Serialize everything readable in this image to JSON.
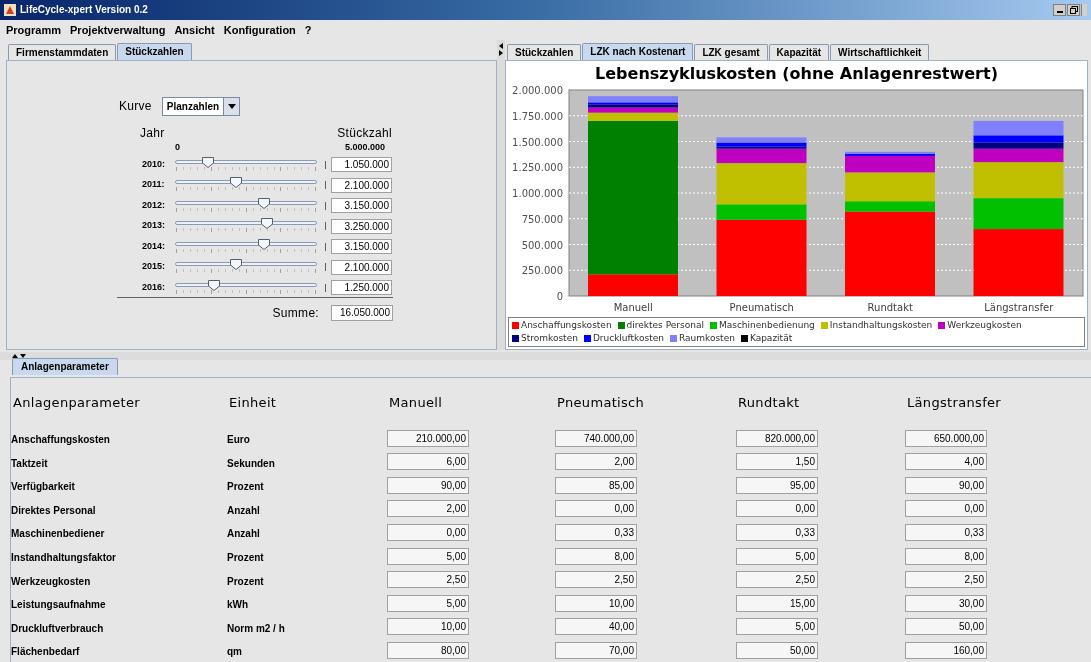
{
  "window": {
    "title": "LifeCycle-xpert Version 0.2"
  },
  "menu": [
    "Programm",
    "Projektverwaltung",
    "Ansicht",
    "Konfiguration",
    "?"
  ],
  "left_tabs": [
    {
      "label": "Firmenstammdaten",
      "selected": false
    },
    {
      "label": "Stückzahlen",
      "selected": true
    }
  ],
  "curve": {
    "label": "Kurve",
    "value": "Planzahlen"
  },
  "years_header": "Jahr",
  "count_header": "Stückzahl",
  "scale_min": "0",
  "scale_max": "5.000.000",
  "years": [
    {
      "label": "2010:",
      "level": 0.21,
      "value": "1.050.000"
    },
    {
      "label": "2011:",
      "level": 0.42,
      "value": "2.100.000"
    },
    {
      "label": "2012:",
      "level": 0.63,
      "value": "3.150.000"
    },
    {
      "label": "2013:",
      "level": 0.65,
      "value": "3.250.000"
    },
    {
      "label": "2014:",
      "level": 0.63,
      "value": "3.150.000"
    },
    {
      "label": "2015:",
      "level": 0.42,
      "value": "2.100.000"
    },
    {
      "label": "2016:",
      "level": 0.25,
      "value": "1.250.000"
    }
  ],
  "sum": {
    "label": "Summe:",
    "value": "16.050.000"
  },
  "chart_tabs": [
    {
      "label": "Stückzahlen",
      "selected": false
    },
    {
      "label": "LZK nach Kostenart",
      "selected": true
    },
    {
      "label": "LZK gesamt",
      "selected": false
    },
    {
      "label": "Kapazität",
      "selected": false
    },
    {
      "label": "Wirtschaftlichkeit",
      "selected": false
    }
  ],
  "chart": {
    "chart_data": {
      "type": "bar",
      "stacked": true,
      "grid": true,
      "legend": "bottom",
      "title": "Lebenszykluskosten (ohne Anlagenrestwert)",
      "categories": [
        "Manuell",
        "Pneumatisch",
        "Rundtakt",
        "Längstransfer"
      ],
      "ylim": [
        0,
        2000000
      ],
      "yticks": [
        {
          "value": 0,
          "label": "0"
        },
        {
          "value": 250000,
          "label": "250.000"
        },
        {
          "value": 500000,
          "label": "500.000"
        },
        {
          "value": 750000,
          "label": "750.000"
        },
        {
          "value": 1000000,
          "label": "1.000.000"
        },
        {
          "value": 1250000,
          "label": "1.250.000"
        },
        {
          "value": 1500000,
          "label": "1.500.000"
        },
        {
          "value": 1750000,
          "label": "1.750.000"
        },
        {
          "value": 2000000,
          "label": "2.000.000"
        }
      ],
      "series": [
        {
          "name": "Anschaffungskosten",
          "color": "#ff0000",
          "values": [
            210000,
            740000,
            820000,
            650000
          ]
        },
        {
          "name": "direktes Personal",
          "color": "#008000",
          "values": [
            1490000,
            0,
            0,
            0
          ]
        },
        {
          "name": "Maschinenbedienung",
          "color": "#00c000",
          "values": [
            0,
            150000,
            100000,
            300000
          ]
        },
        {
          "name": "Instandhaltungskosten",
          "color": "#c0c000",
          "values": [
            80000,
            400000,
            280000,
            350000
          ]
        },
        {
          "name": "Werkzeugkosten",
          "color": "#c000c0",
          "values": [
            50000,
            140000,
            160000,
            130000
          ]
        },
        {
          "name": "Stromkosten",
          "color": "#000080",
          "values": [
            30000,
            20000,
            0,
            60000
          ]
        },
        {
          "name": "Druckluftkosten",
          "color": "#0000ff",
          "values": [
            20000,
            40000,
            20000,
            70000
          ]
        },
        {
          "name": "Raumkosten",
          "color": "#8080ff",
          "values": [
            60000,
            50000,
            20000,
            140000
          ]
        },
        {
          "name": "Kapazität",
          "color": "#000000",
          "values": [
            0,
            0,
            0,
            0
          ]
        }
      ]
    }
  },
  "params_tab": {
    "label": "Anlagenparameter",
    "selected": true
  },
  "table": {
    "columns": [
      "Anlagenparameter",
      "Einheit",
      "Manuell",
      "Pneumatisch",
      "Rundtakt",
      "Längstransfer"
    ],
    "rows": [
      {
        "name": "Anschaffungskosten",
        "unit": "Euro",
        "values": [
          "210.000,00",
          "740.000,00",
          "820.000,00",
          "650.000,00"
        ]
      },
      {
        "name": "Taktzeit",
        "unit": "Sekunden",
        "values": [
          "6,00",
          "2,00",
          "1,50",
          "4,00"
        ]
      },
      {
        "name": "Verfügbarkeit",
        "unit": "Prozent",
        "values": [
          "90,00",
          "85,00",
          "95,00",
          "90,00"
        ]
      },
      {
        "name": "Direktes Personal",
        "unit": "Anzahl",
        "values": [
          "2,00",
          "0,00",
          "0,00",
          "0,00"
        ]
      },
      {
        "name": "Maschinenbediener",
        "unit": "Anzahl",
        "values": [
          "0,00",
          "0,33",
          "0,33",
          "0,33"
        ]
      },
      {
        "name": "Instandhaltungsfaktor",
        "unit": "Prozent",
        "values": [
          "5,00",
          "8,00",
          "5,00",
          "8,00"
        ]
      },
      {
        "name": "Werkzeugkosten",
        "unit": "Prozent",
        "values": [
          "2,50",
          "2,50",
          "2,50",
          "2,50"
        ]
      },
      {
        "name": "Leistungsaufnahme",
        "unit": "kWh",
        "values": [
          "5,00",
          "10,00",
          "15,00",
          "30,00"
        ]
      },
      {
        "name": "Druckluftverbrauch",
        "unit": "Norm m2 / h",
        "values": [
          "10,00",
          "40,00",
          "5,00",
          "50,00"
        ]
      },
      {
        "name": "Flächenbedarf",
        "unit": "qm",
        "values": [
          "80,00",
          "70,00",
          "50,00",
          "160,00"
        ]
      }
    ]
  }
}
